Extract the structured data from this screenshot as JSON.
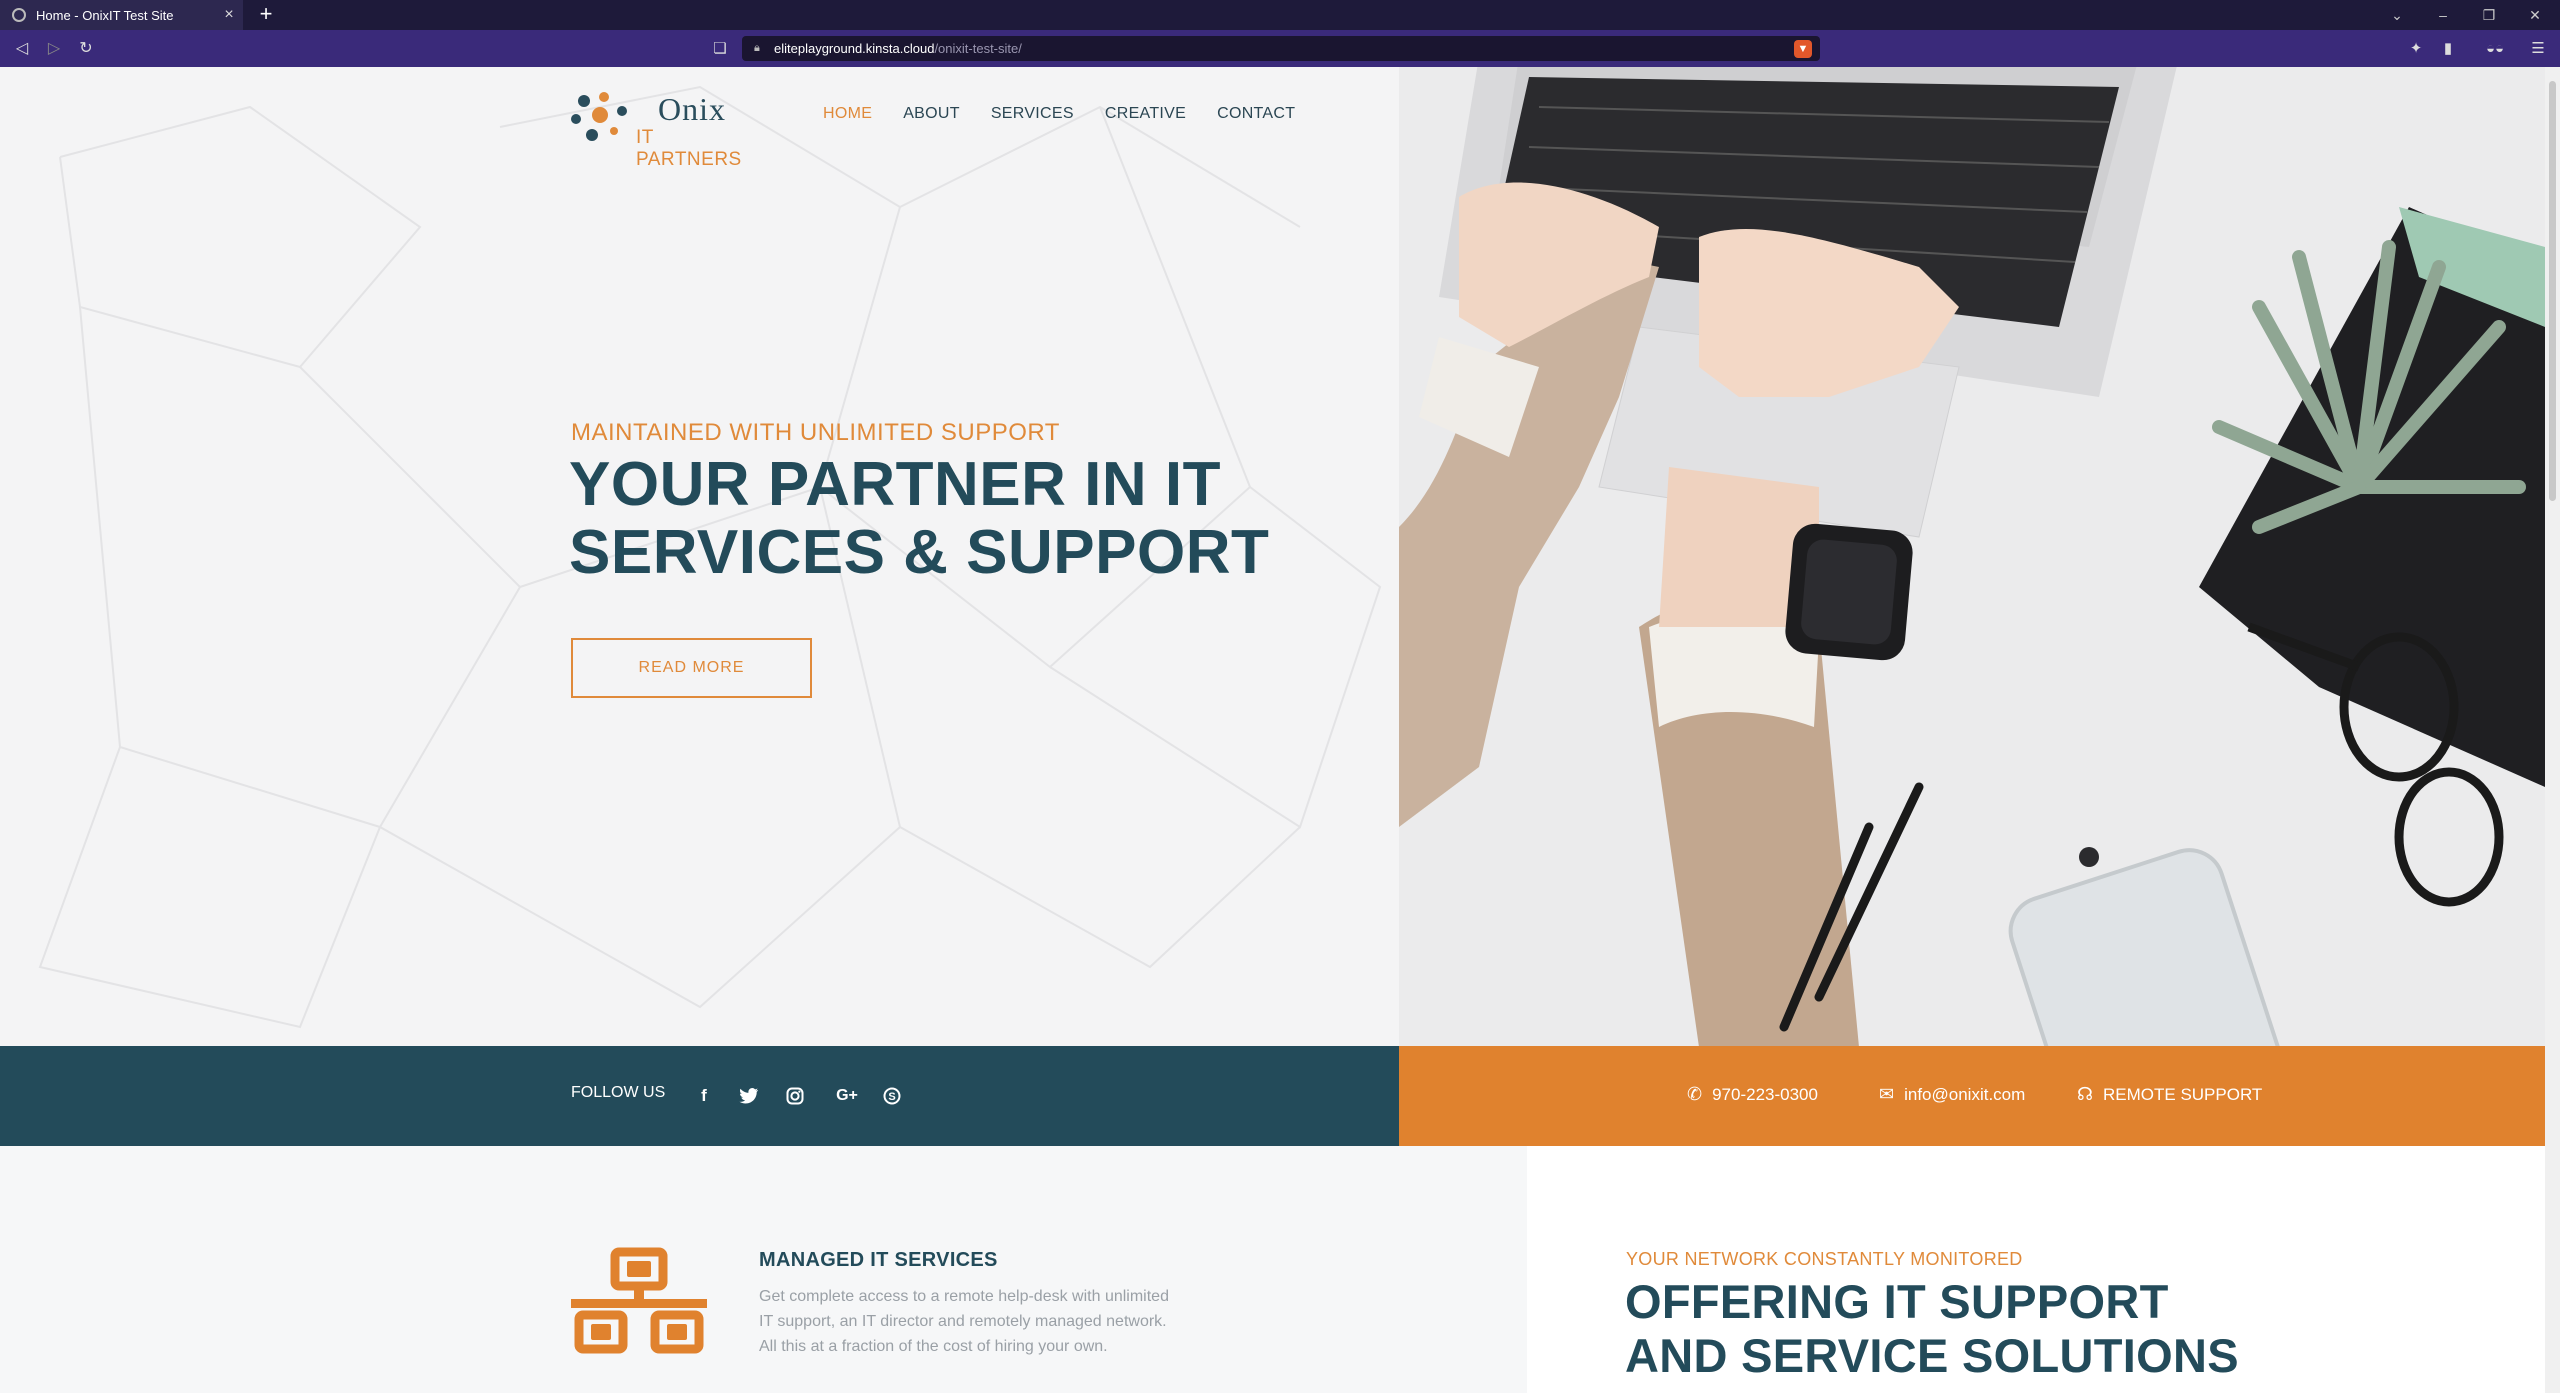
{
  "browser": {
    "tab_title": "Home - OnixIT Test Site",
    "url_host": "eliteplayground.kinsta.cloud",
    "url_path": "/onixit-test-site/"
  },
  "logo": {
    "name": "Onix",
    "sub_it": "IT",
    "sub_partners": "PARTNERS"
  },
  "nav": {
    "items": [
      {
        "label": "HOME",
        "active": true
      },
      {
        "label": "ABOUT"
      },
      {
        "label": "SERVICES"
      },
      {
        "label": "CREATIVE"
      },
      {
        "label": "CONTACT"
      }
    ]
  },
  "hero": {
    "kicker": "MAINTAINED WITH UNLIMITED SUPPORT",
    "headline_line1": "YOUR PARTNER IN IT",
    "headline_line2": "SERVICES & SUPPORT",
    "button_label": "READ MORE"
  },
  "follow": {
    "label": "FOLLOW US",
    "icons": [
      "facebook-icon",
      "twitter-icon",
      "instagram-icon",
      "google-plus-icon",
      "skype-icon"
    ]
  },
  "contact": {
    "phone": "970-223-0300",
    "email": "info@onixit.com",
    "remote": "REMOTE SUPPORT"
  },
  "service": {
    "title": "MANAGED IT SERVICES",
    "desc_line1": "Get complete access to a remote help-desk with unlimited",
    "desc_line2": "IT support, an IT director and remotely managed network.",
    "desc_line3": "All this at a fraction of the cost of hiring your own."
  },
  "section2": {
    "kicker": "YOUR NETWORK CONSTANTLY MONITORED",
    "headline_line1": "OFFERING IT SUPPORT",
    "headline_line2": "AND SERVICE SOLUTIONS"
  },
  "colors": {
    "accent": "#e08a3a",
    "primary": "#234b5a",
    "chrome": "#3a2a7a"
  }
}
